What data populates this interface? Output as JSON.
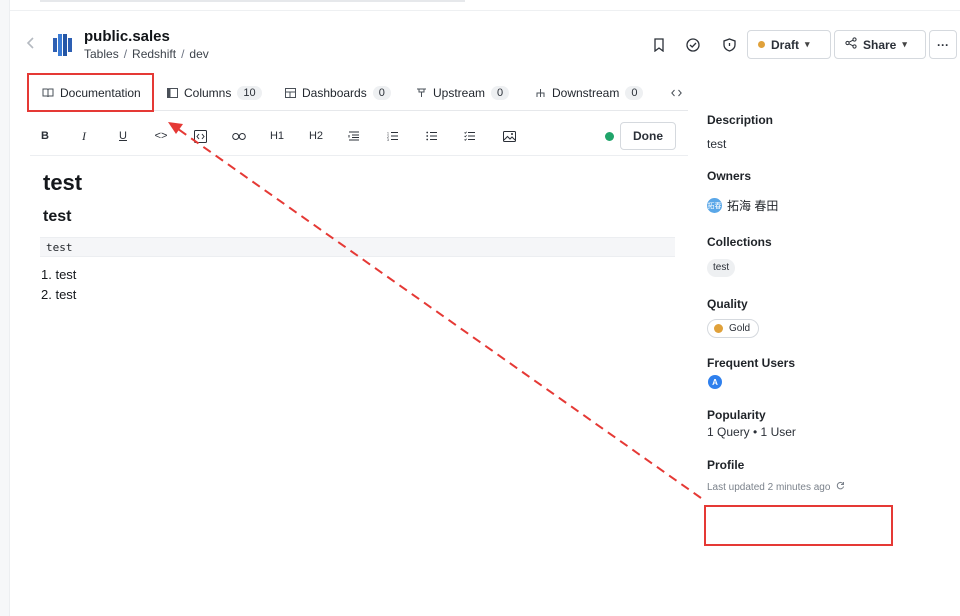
{
  "header": {
    "title": "public.sales",
    "breadcrumb": [
      "Tables",
      "Redshift",
      "dev"
    ],
    "breadcrumb_sep": "/",
    "draft_label": "Draft",
    "share_label": "Share",
    "more_label": "···"
  },
  "tabs": [
    {
      "label": "Documentation",
      "count": null
    },
    {
      "label": "Columns",
      "count": "10"
    },
    {
      "label": "Dashboards",
      "count": "0"
    },
    {
      "label": "Upstream",
      "count": "0"
    },
    {
      "label": "Downstream",
      "count": "0"
    }
  ],
  "toolbar": {
    "bold": "B",
    "italic": "I",
    "underline": "U",
    "code": "<>",
    "h1": "H1",
    "h2": "H2",
    "done_label": "Done"
  },
  "document": {
    "heading1": "test",
    "heading2": "test",
    "code": "test",
    "list": [
      "test",
      "test"
    ]
  },
  "sidebar": {
    "description_label": "Description",
    "description_value": "test",
    "owners_label": "Owners",
    "owner_initials": "拓春",
    "owner_name": "拓海 春田",
    "collections_label": "Collections",
    "collection_chip": "test",
    "quality_label": "Quality",
    "quality_value": "Gold",
    "frequent_users_label": "Frequent Users",
    "frequent_user_initial": "A",
    "popularity_label": "Popularity",
    "popularity_value": "1 Query • 1 User",
    "profile_label": "Profile",
    "profile_updated": "Last updated 2 minutes ago"
  },
  "colors": {
    "accent_annotation": "#e53935",
    "draft_dot": "#e0a13a",
    "status_dot": "#20a46a",
    "user_avatar": "#2f80ed"
  }
}
